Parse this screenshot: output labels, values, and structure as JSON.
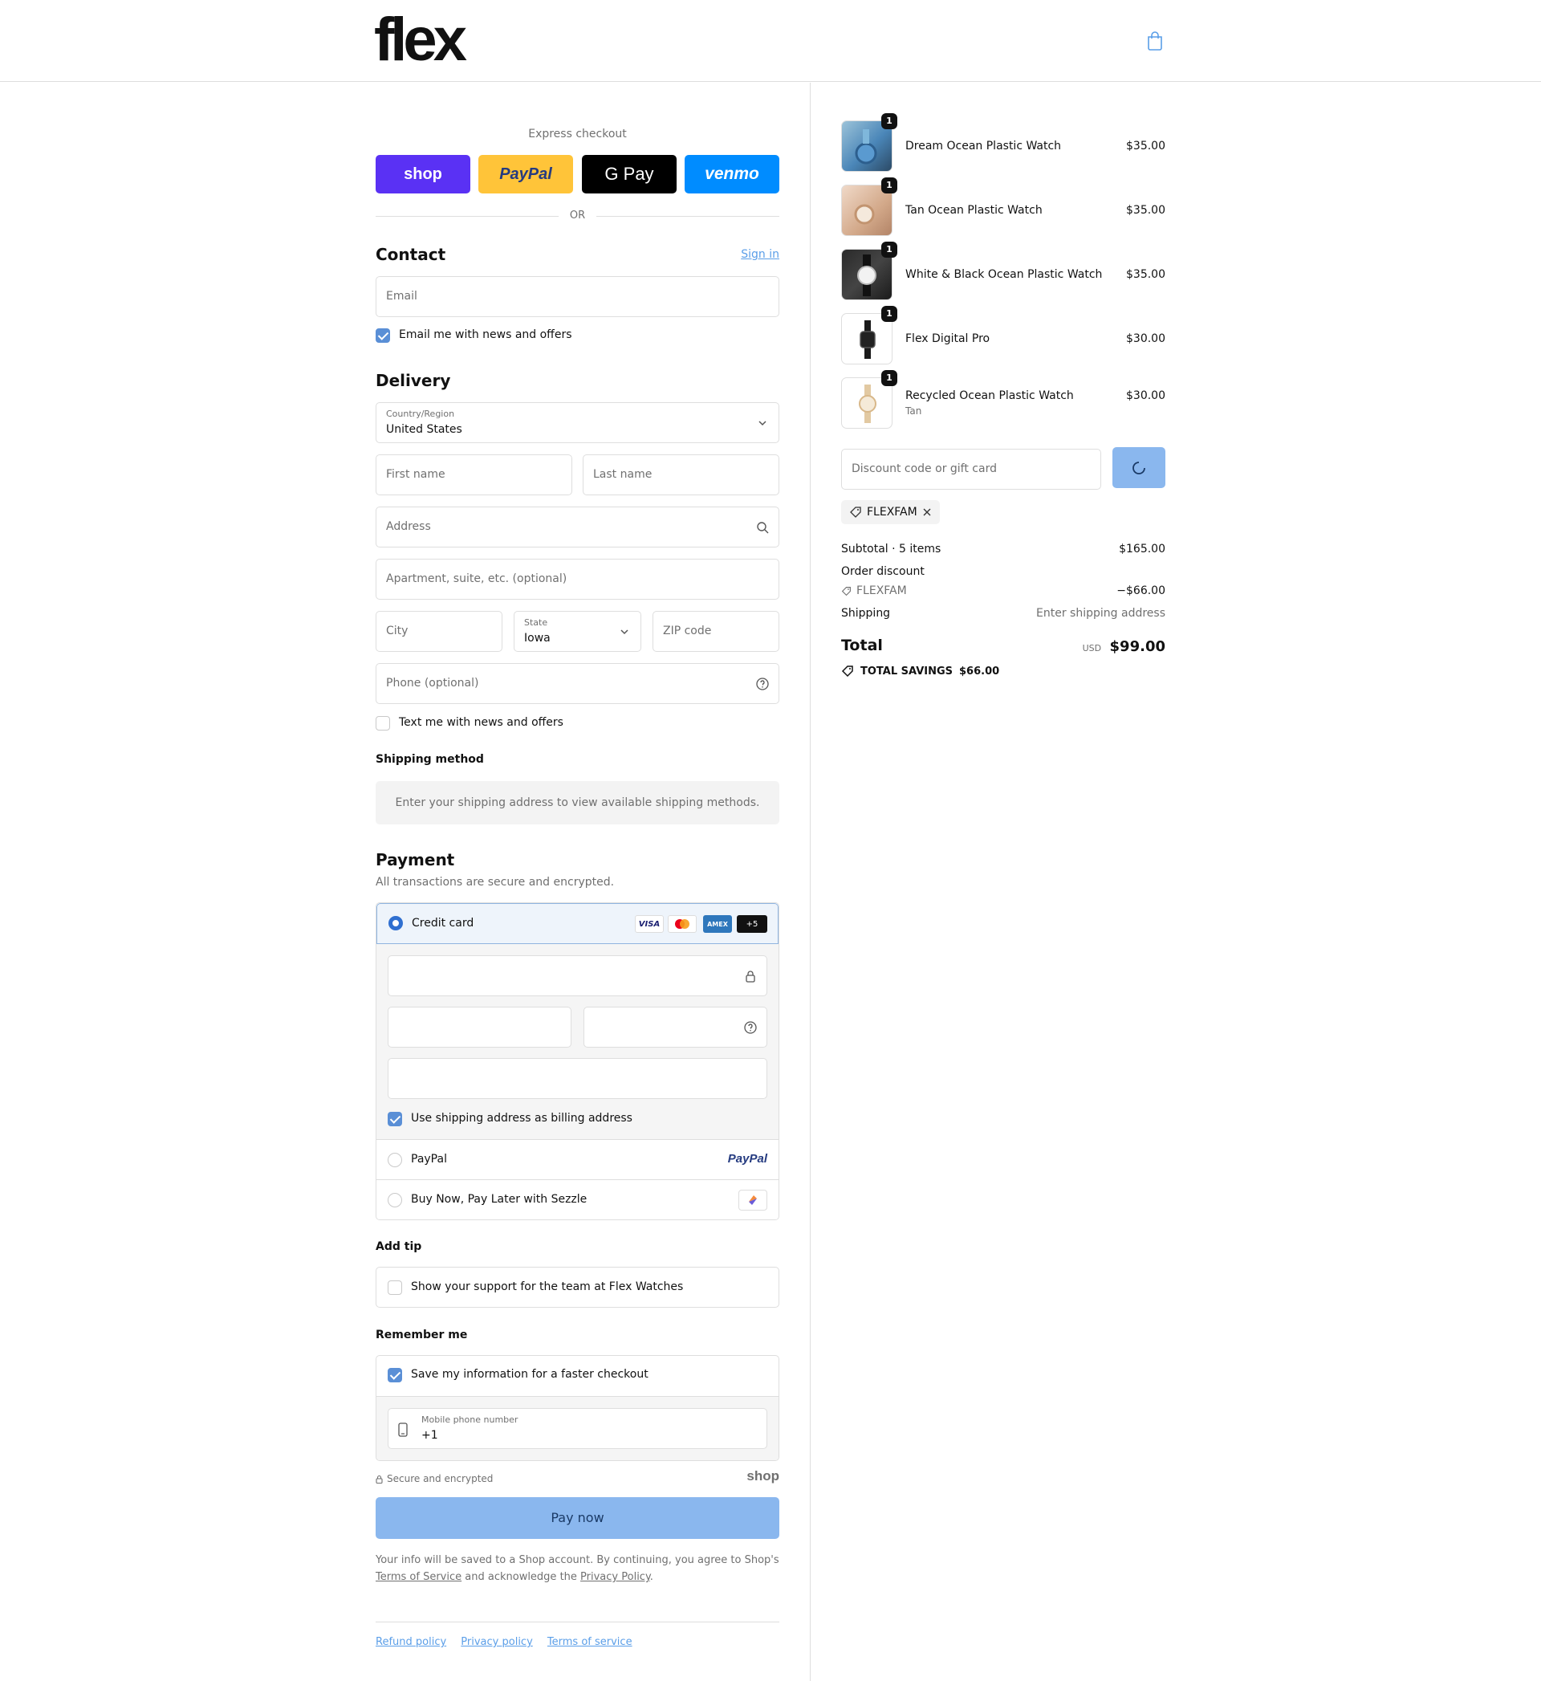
{
  "header": {
    "logo": "flex",
    "cart_icon": "shopping-bag-icon"
  },
  "express": {
    "label": "Express checkout",
    "buttons": [
      {
        "label": "shop",
        "color": "#5a31f4"
      },
      {
        "label": "PayPal",
        "color": "#ffc439"
      },
      {
        "label": "G Pay",
        "color": "#000000"
      },
      {
        "label": "venmo",
        "color": "#008cff"
      }
    ],
    "or": "OR"
  },
  "contact": {
    "title": "Contact",
    "sign_in": "Sign in",
    "email_placeholder": "Email",
    "news_label": "Email me with news and offers",
    "news_checked": true
  },
  "delivery": {
    "title": "Delivery",
    "country_label": "Country/Region",
    "country_value": "United States",
    "first_name": "First name",
    "last_name": "Last name",
    "address": "Address",
    "apartment": "Apartment, suite, etc. (optional)",
    "city": "City",
    "state_label": "State",
    "state_value": "Iowa",
    "zip": "ZIP code",
    "phone": "Phone (optional)",
    "text_label": "Text me with news and offers",
    "text_checked": false
  },
  "shipping_method": {
    "title": "Shipping method",
    "message": "Enter your shipping address to view available shipping methods."
  },
  "payment": {
    "title": "Payment",
    "subtitle": "All transactions are secure and encrypted.",
    "credit_card": "Credit card",
    "card_badges": [
      "VISA",
      "",
      "AMEX",
      "+5"
    ],
    "billing_label": "Use shipping address as billing address",
    "paypal": "PayPal",
    "paypal_logo": "PayPal",
    "sezzle": "Buy Now, Pay Later with Sezzle"
  },
  "tip": {
    "title": "Add tip",
    "label": "Show your support for the team at Flex Watches"
  },
  "remember": {
    "title": "Remember me",
    "label": "Save my information for a faster checkout",
    "phone_label": "Mobile phone number",
    "phone_value": "+1",
    "secure": "Secure and encrypted",
    "shop_logo": "shop"
  },
  "pay_now": "Pay now",
  "legal": {
    "text1": "Your info will be saved to a Shop account. By continuing, you agree to Shop's",
    "tos": "Terms of Service",
    "text2": "and acknowledge the",
    "privacy": "Privacy Policy",
    "text3": "."
  },
  "footer": {
    "links": [
      "Refund policy",
      "Privacy policy",
      "Terms of service"
    ]
  },
  "cart": {
    "items": [
      {
        "name": "Dream Ocean Plastic Watch",
        "variant": "",
        "qty": "1",
        "price": "$35.00"
      },
      {
        "name": "Tan Ocean Plastic Watch",
        "variant": "",
        "qty": "1",
        "price": "$35.00"
      },
      {
        "name": "White & Black Ocean Plastic Watch",
        "variant": "",
        "qty": "1",
        "price": "$35.00"
      },
      {
        "name": "Flex Digital Pro",
        "variant": "",
        "qty": "1",
        "price": "$30.00"
      },
      {
        "name": "Recycled Ocean Plastic Watch",
        "variant": "Tan",
        "qty": "1",
        "price": "$30.00"
      }
    ],
    "discount_placeholder": "Discount code or gift card",
    "applied_code": "FLEXFAM",
    "subtotal_label": "Subtotal · 5 items",
    "subtotal_value": "$165.00",
    "order_discount_label": "Order discount",
    "discount_code": "FLEXFAM",
    "discount_value": "−$66.00",
    "shipping_label": "Shipping",
    "shipping_value": "Enter shipping address",
    "total_label": "Total",
    "currency": "USD",
    "total_value": "$99.00",
    "savings_label": "TOTAL SAVINGS",
    "savings_value": "$66.00"
  }
}
